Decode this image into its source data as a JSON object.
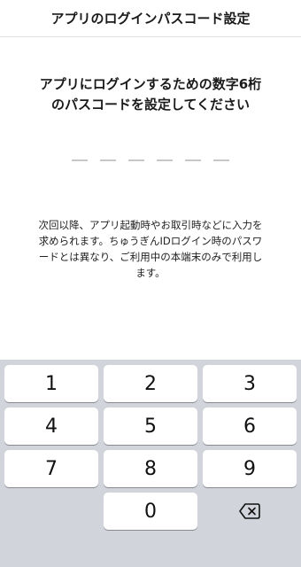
{
  "header": {
    "title": "アプリのログインパスコード設定"
  },
  "prompt": {
    "line1": "アプリにログインするための数字6桁",
    "line2": "のパスコードを設定してください"
  },
  "passcode": {
    "length": 6,
    "entered": 0
  },
  "note": {
    "text": "次回以降、アプリ起動時やお取引時などに入力を求められます。ちゅうぎんIDログイン時のパスワードとは異なり、ご利用中の本端末のみで利用します。"
  },
  "keypad": {
    "row1": [
      "1",
      "2",
      "3"
    ],
    "row2": [
      "4",
      "5",
      "6"
    ],
    "row3": [
      "7",
      "8",
      "9"
    ],
    "row4": [
      "0"
    ],
    "delete_icon": "backspace-icon"
  }
}
